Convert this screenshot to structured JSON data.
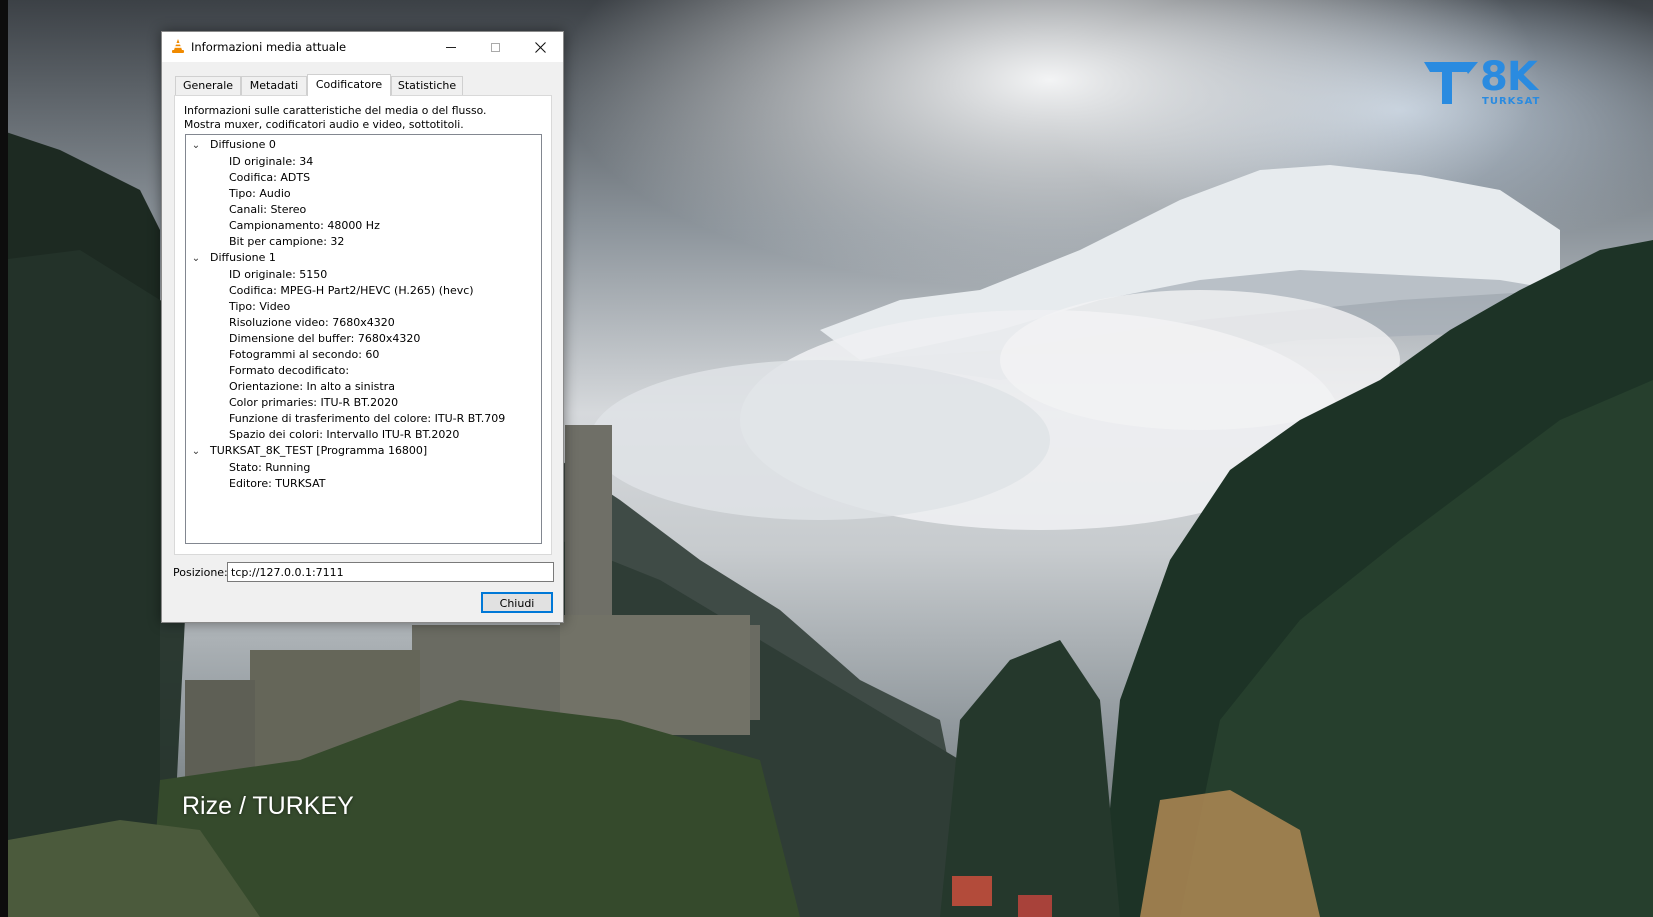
{
  "background": {
    "caption": "Rize / TURKEY",
    "brand": {
      "name": "8K",
      "sub": "TURKSAT",
      "color": "#2a8be0"
    }
  },
  "dialog": {
    "title": "Informazioni media attuale",
    "app_icon": "vlc-cone-icon",
    "tabs": [
      {
        "label": "Generale",
        "active": false
      },
      {
        "label": "Metadati",
        "active": false
      },
      {
        "label": "Codificatore",
        "active": true
      },
      {
        "label": "Statistiche",
        "active": false
      }
    ],
    "description_line1": "Informazioni sulle caratteristiche del media o del flusso.",
    "description_line2": "Mostra muxer, codificatori audio e video, sottotitoli.",
    "tree": [
      {
        "label": "Diffusione 0",
        "expanded": true,
        "children": [
          "ID originale: 34",
          "Codifica: ADTS",
          "Tipo: Audio",
          "Canali: Stereo",
          "Campionamento: 48000 Hz",
          "Bit per campione: 32"
        ]
      },
      {
        "label": "Diffusione 1",
        "expanded": true,
        "children": [
          "ID originale: 5150",
          "Codifica: MPEG-H Part2/HEVC (H.265) (hevc)",
          "Tipo: Video",
          "Risoluzione video: 7680x4320",
          "Dimensione del buffer: 7680x4320",
          "Fotogrammi al secondo: 60",
          "Formato decodificato:",
          "Orientazione: In alto a sinistra",
          "Color primaries: ITU-R BT.2020",
          "Funzione di trasferimento del colore: ITU-R BT.709",
          "Spazio dei colori: Intervallo ITU-R BT.2020"
        ]
      },
      {
        "label": "TURKSAT_8K_TEST [Programma 16800]",
        "expanded": true,
        "children": [
          "Stato: Running",
          "Editore: TURKSAT"
        ]
      }
    ],
    "position_label": "Posizione:",
    "position_value": "tcp://127.0.0.1:7111",
    "close_label": "Chiudi",
    "accent": "#0078d7"
  }
}
